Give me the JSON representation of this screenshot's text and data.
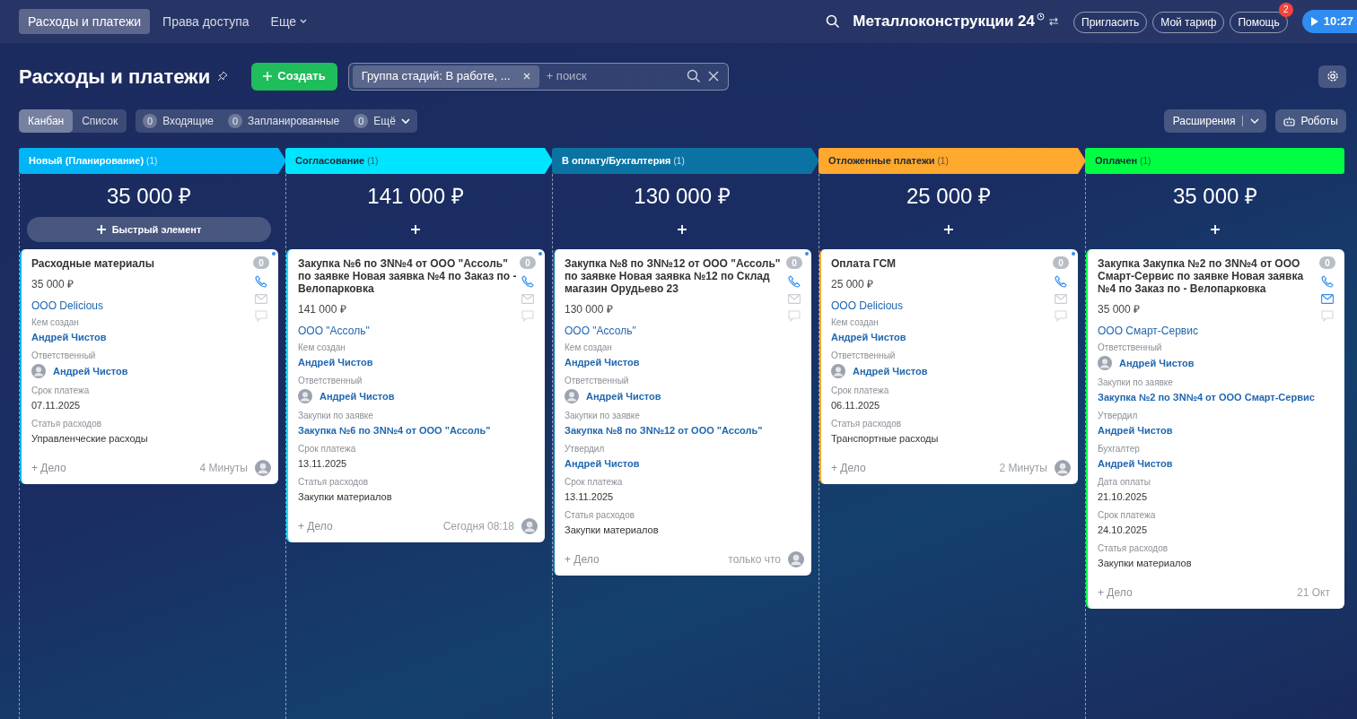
{
  "top_nav": {
    "tabs": [
      {
        "label": "Расходы и платежи",
        "selected": true
      },
      {
        "label": "Права доступа",
        "selected": false
      }
    ],
    "more": "Еще"
  },
  "portal": {
    "name": "Металлоконструкции",
    "suffix": "24",
    "buttons": [
      "Пригласить",
      "Мой тариф",
      "Помощь"
    ],
    "help_badge": "2",
    "time": "10:27"
  },
  "page": {
    "title": "Расходы и платежи",
    "create": "Создать",
    "filter_chip": "Группа стадий: В работе, ...",
    "search_placeholder": "+ поиск"
  },
  "views": [
    {
      "label": "Канбан",
      "selected": true
    },
    {
      "label": "Список",
      "selected": false
    }
  ],
  "counters": [
    {
      "count": "0",
      "label": "Входящие",
      "dropdown": false
    },
    {
      "count": "0",
      "label": "Запланированные",
      "dropdown": false
    },
    {
      "count": "0",
      "label": "Ещё",
      "dropdown": true
    }
  ],
  "actions": [
    {
      "label": "Расширения",
      "kind": "split"
    },
    {
      "label": "Роботы",
      "kind": "robot"
    }
  ],
  "columns": [
    {
      "title": "Новый (Планирование)",
      "count": "(1)",
      "color": "#00b4f5",
      "arrow": true,
      "sum": "35 000 ₽",
      "quick_add": "Быстрый элемент",
      "cards": [
        {
          "title": "Расходные материалы",
          "amount": "35 000 ₽",
          "company": "ООО Delicious",
          "counter": "0",
          "unread": true,
          "email_active": false,
          "avatar": true,
          "time": "4 Минуты",
          "add": "+ Дело",
          "fields": [
            {
              "label": "Кем создан",
              "value": "Андрей Чистов",
              "kind": "link"
            },
            {
              "label": "Ответственный",
              "value": "Андрей Чистов",
              "kind": "user"
            },
            {
              "label": "Срок платежа",
              "value": "07.11.2025",
              "kind": "text"
            },
            {
              "label": "Статья расходов",
              "value": "Управленческие расходы",
              "kind": "text"
            }
          ]
        }
      ]
    },
    {
      "title": "Согласование",
      "count": "(1)",
      "color": "#00e5ff",
      "arrow": true,
      "sum": "141 000 ₽",
      "cards": [
        {
          "title": "Закупка №6 по ЗN№4 от ООО \"Ассоль\" по заявке Новая заявка №4 по Заказ по - Велопарковка",
          "amount": "141 000 ₽",
          "company": "ООО \"Ассоль\"",
          "counter": "0",
          "unread": true,
          "email_active": false,
          "avatar": true,
          "time": "Сегодня 08:18",
          "add": "+ Дело",
          "fields": [
            {
              "label": "Кем создан",
              "value": "Андрей Чистов",
              "kind": "link"
            },
            {
              "label": "Ответственный",
              "value": "Андрей Чистов",
              "kind": "user"
            },
            {
              "label": "Закупки по заявке",
              "value": "Закупка №6 по ЗN№4 от ООО \"Ассоль\"",
              "kind": "link"
            },
            {
              "label": "Срок платежа",
              "value": "13.11.2025",
              "kind": "text"
            },
            {
              "label": "Статья расходов",
              "value": "Закупки материалов",
              "kind": "text"
            }
          ]
        }
      ]
    },
    {
      "title": "В оплату/Бухгалтерия",
      "count": "(1)",
      "color": "#0a73a3",
      "arrow": true,
      "sum": "130 000 ₽",
      "cards": [
        {
          "title": "Закупка №8 по ЗN№12 от ООО \"Ассоль\" по заявке Новая заявка №12 по Склад магазин Орудьево 23",
          "amount": "130 000 ₽",
          "company": "ООО \"Ассоль\"",
          "counter": "0",
          "unread": true,
          "email_active": false,
          "avatar": true,
          "time": "только что",
          "add": "+ Дело",
          "fields": [
            {
              "label": "Кем создан",
              "value": "Андрей Чистов",
              "kind": "link"
            },
            {
              "label": "Ответственный",
              "value": "Андрей Чистов",
              "kind": "user"
            },
            {
              "label": "Закупки по заявке",
              "value": "Закупка №8 по ЗN№12 от ООО \"Ассоль\"",
              "kind": "link"
            },
            {
              "label": "Утвердил",
              "value": "Андрей Чистов",
              "kind": "link"
            },
            {
              "label": "Срок платежа",
              "value": "13.11.2025",
              "kind": "text"
            },
            {
              "label": "Статья расходов",
              "value": "Закупки материалов",
              "kind": "text"
            }
          ]
        }
      ]
    },
    {
      "title": "Отложенные платежи",
      "count": "(1)",
      "color": "#ffa82e",
      "arrow": true,
      "sum": "25 000 ₽",
      "cards": [
        {
          "title": "Оплата ГСМ",
          "amount": "25 000 ₽",
          "company": "ООО Delicious",
          "counter": "0",
          "unread": true,
          "email_active": false,
          "avatar": true,
          "time": "2 Минуты",
          "add": "+ Дело",
          "fields": [
            {
              "label": "Кем создан",
              "value": "Андрей Чистов",
              "kind": "link"
            },
            {
              "label": "Ответственный",
              "value": "Андрей Чистов",
              "kind": "user"
            },
            {
              "label": "Срок платежа",
              "value": "06.11.2025",
              "kind": "text"
            },
            {
              "label": "Статья расходов",
              "value": "Транспортные расходы",
              "kind": "text"
            }
          ]
        }
      ]
    },
    {
      "title": "Оплачен",
      "count": "(1)",
      "color": "#00ff43",
      "arrow": false,
      "sum": "35 000 ₽",
      "cards": [
        {
          "title": "Закупка Закупка №2 по ЗN№4 от ООО Смарт-Сервис по заявке Новая заявка №4 по Заказ по - Велопарковка",
          "amount": "35 000 ₽",
          "company": "ООО Смарт-Сервис",
          "counter": "0",
          "unread": false,
          "email_active": true,
          "avatar": false,
          "time": "21 Окт",
          "add": "+ Дело",
          "fields": [
            {
              "label": "Ответственный",
              "value": "Андрей Чистов",
              "kind": "user"
            },
            {
              "label": "Закупки по заявке",
              "value": "Закупка №2 по ЗN№4 от ООО Смарт-Сервис",
              "kind": "link"
            },
            {
              "label": "Утвердил",
              "value": "Андрей Чистов",
              "kind": "link"
            },
            {
              "label": "Бухгалтер",
              "value": "Андрей Чистов",
              "kind": "link"
            },
            {
              "label": "Дата оплаты",
              "value": "21.10.2025",
              "kind": "text"
            },
            {
              "label": "Срок платежа",
              "value": "24.10.2025",
              "kind": "text"
            },
            {
              "label": "Статья расходов",
              "value": "Закупки материалов",
              "kind": "text"
            }
          ]
        }
      ]
    }
  ]
}
